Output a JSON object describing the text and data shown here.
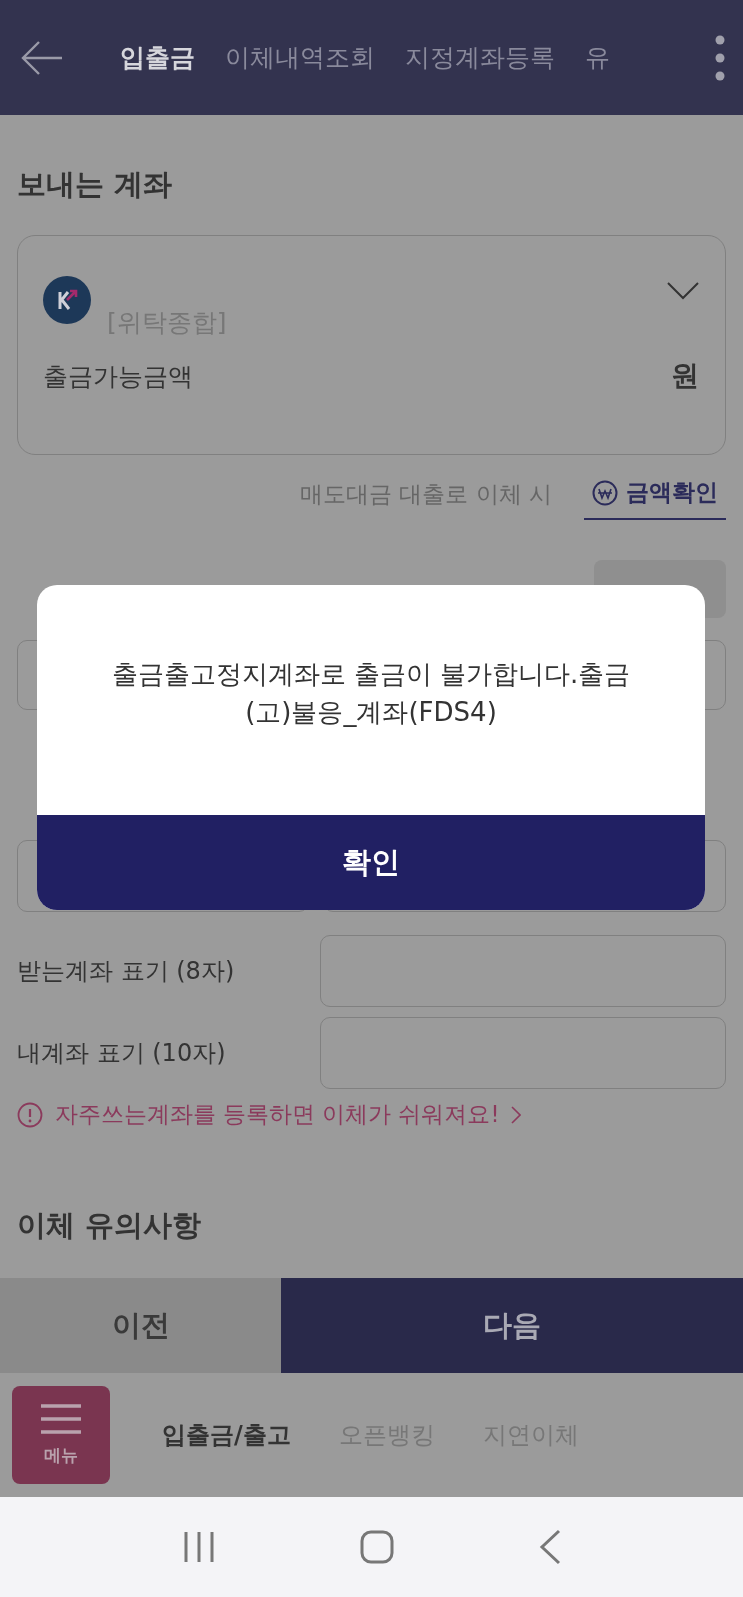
{
  "header": {
    "tabs": [
      {
        "label": "입출금",
        "selected": true
      },
      {
        "label": "이체내역조회",
        "selected": false
      },
      {
        "label": "지정계좌등록",
        "selected": false
      },
      {
        "label": "유",
        "selected": false
      }
    ]
  },
  "sender": {
    "title": "보내는 계좌",
    "account_type": "[위탁종합]",
    "balance_label": "출금가능금액",
    "balance_unit": "원"
  },
  "loan_note": {
    "text": "매도대금 대출로 이체 시",
    "link": "금액확인"
  },
  "display_fields": [
    {
      "label": "받는계좌 표기 (8자)"
    },
    {
      "label": "내계좌 표기 (10자)"
    }
  ],
  "notice": "자주쓰는계좌를 등록하면 이체가 쉬워져요!",
  "caution_title": "이체 유의사항",
  "actions": {
    "prev": "이전",
    "next": "다음"
  },
  "bottom_menu": {
    "menu_label": "메뉴",
    "tabs": [
      {
        "label": "입출금/출고",
        "selected": true
      },
      {
        "label": "오픈뱅킹",
        "selected": false
      },
      {
        "label": "지연이체",
        "selected": false
      }
    ]
  },
  "dialog": {
    "message": "출금출고정지계좌로 출금이 불가합니다.출금(고)불응_계좌(FDS4)",
    "confirm": "확인"
  }
}
